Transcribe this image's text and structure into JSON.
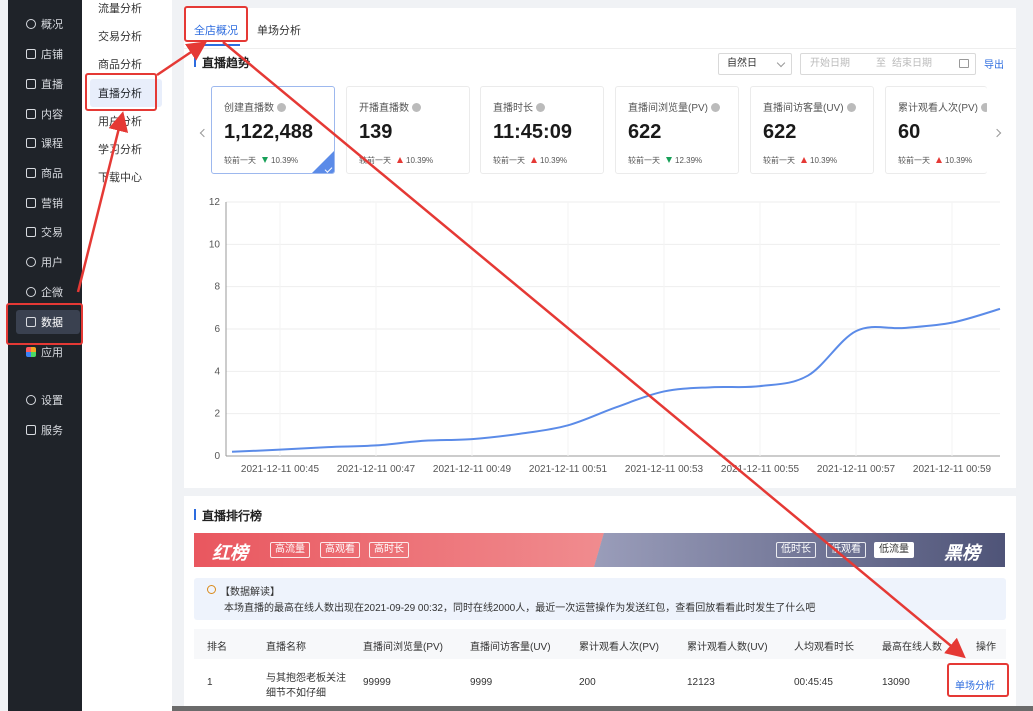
{
  "nav": {
    "items": [
      {
        "label": "概况",
        "icon": "clock-icon"
      },
      {
        "label": "店铺",
        "icon": "store-icon"
      },
      {
        "label": "直播",
        "icon": "live-icon"
      },
      {
        "label": "内容",
        "icon": "document-icon"
      },
      {
        "label": "课程",
        "icon": "book-icon"
      },
      {
        "label": "商品",
        "icon": "shop-bag-icon"
      },
      {
        "label": "营销",
        "icon": "megaphone-icon"
      },
      {
        "label": "交易",
        "icon": "transaction-icon"
      },
      {
        "label": "用户",
        "icon": "user-icon"
      },
      {
        "label": "企微",
        "icon": "wecom-icon"
      },
      {
        "label": "数据",
        "icon": "data-icon"
      },
      {
        "label": "应用",
        "icon": "apps-grid-icon"
      },
      {
        "label": "设置",
        "icon": "gear-icon"
      },
      {
        "label": "服务",
        "icon": "service-icon"
      }
    ]
  },
  "submenu": {
    "items": [
      "流量分析",
      "交易分析",
      "商品分析",
      "直播分析",
      "用户分析",
      "学习分析",
      "下载中心"
    ]
  },
  "tabs": [
    "全店概况",
    "单场分析"
  ],
  "trend": {
    "title": "直播趋势",
    "select_value": "自然日",
    "start_placeholder": "开始日期",
    "separator": "至",
    "end_placeholder": "结束日期",
    "export": "导出"
  },
  "kpis": [
    {
      "label": "创建直播数",
      "value": "1,122,488",
      "compare": "较前一天",
      "change": "10.39%",
      "dir": "down"
    },
    {
      "label": "开播直播数",
      "value": "139",
      "compare": "较前一天",
      "change": "10.39%",
      "dir": "up"
    },
    {
      "label": "直播时长",
      "value": "11:45:09",
      "compare": "较前一天",
      "change": "10.39%",
      "dir": "up"
    },
    {
      "label": "直播间浏览量(PV)",
      "value": "622",
      "compare": "较前一天",
      "change": "12.39%",
      "dir": "down"
    },
    {
      "label": "直播间访客量(UV)",
      "value": "622",
      "compare": "较前一天",
      "change": "10.39%",
      "dir": "up"
    },
    {
      "label": "累计观看人次(PV)",
      "value": "60",
      "compare": "较前一天",
      "change": "10.39%",
      "dir": "up"
    }
  ],
  "chart_data": {
    "type": "line",
    "title": "",
    "xlabel": "",
    "ylabel": "",
    "ylim": [
      0,
      12
    ],
    "yticks": [
      "0",
      "2",
      "4",
      "6",
      "8",
      "10",
      "12"
    ],
    "xticks": [
      "2021-12-11 00:45",
      "2021-12-11 00:47",
      "2021-12-11 00:49",
      "2021-12-11 00:51",
      "2021-12-11 00:53",
      "2021-12-11 00:55",
      "2021-12-11 00:57",
      "2021-12-11 00:59"
    ],
    "grid": true,
    "color": "#5b8be8",
    "series": [
      {
        "x": [
          "00:44",
          "00:45",
          "00:46",
          "00:47",
          "00:48",
          "00:49",
          "00:50",
          "00:51",
          "00:52",
          "00:53",
          "00:54",
          "00:55",
          "00:56",
          "00:57",
          "00:58",
          "00:59",
          "01:00"
        ],
        "values": [
          0.2,
          0.3,
          0.42,
          0.5,
          0.72,
          0.8,
          1.05,
          1.45,
          2.3,
          3.05,
          3.25,
          3.3,
          3.8,
          5.9,
          6.05,
          6.3,
          6.95
        ]
      }
    ]
  },
  "ranking": {
    "title": "直播排行榜",
    "red_title": "红榜",
    "red_tags": [
      "高流量",
      "高观看",
      "高时长"
    ],
    "black_title": "黑榜",
    "black_tags": [
      "低时长",
      "低观看",
      "低流量"
    ],
    "info_title": "【数据解读】",
    "info_text": "本场直播的最高在线人数出现在2021-09-29 00:32，同时在线2000人，最近一次运营操作为发送红包，查看回放看看此时发生了什么吧",
    "columns": [
      "排名",
      "直播名称",
      "直播间浏览量(PV)",
      "直播间访客量(UV)",
      "累计观看人次(PV)",
      "累计观看人数(UV)",
      "人均观看时长",
      "最高在线人数",
      "操作"
    ],
    "rows": [
      {
        "rank": "1",
        "name_line1": "与其抱怨老板关注",
        "name_line2": "细节不如仔细",
        "pv": "99999",
        "uv": "9999",
        "views": "200",
        "viewers": "12123",
        "avg_time": "00:45:45",
        "peak": "13090",
        "action": "单场分析"
      }
    ]
  }
}
